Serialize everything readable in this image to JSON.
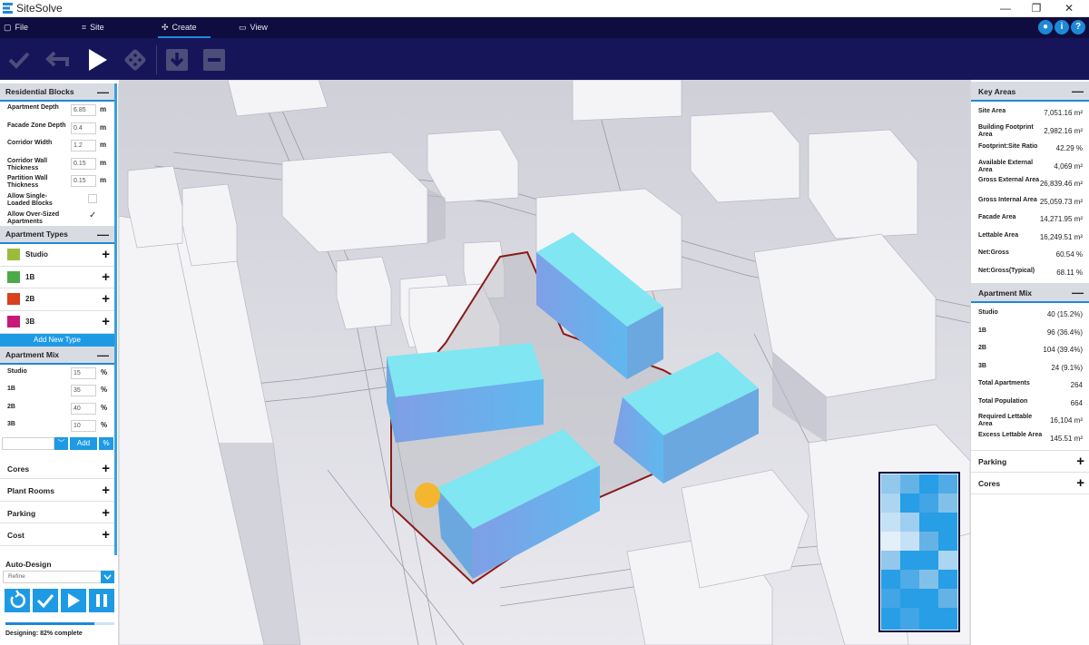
{
  "app": {
    "title": "SiteSolve"
  },
  "window": {
    "minimize": "—",
    "restore": "❐",
    "close": "✕"
  },
  "menu": {
    "tabs": [
      {
        "label": "File",
        "icon": "file-icon"
      },
      {
        "label": "Site",
        "icon": "site-icon"
      },
      {
        "label": "Create",
        "icon": "create-icon",
        "active": true
      },
      {
        "label": "View",
        "icon": "view-icon"
      }
    ],
    "help_icons": [
      "user-icon",
      "info-icon",
      "help-icon"
    ]
  },
  "toolbar": [
    "check-icon",
    "undo-icon",
    "play-icon",
    "dice-icon",
    "download-icon",
    "minus-icon"
  ],
  "left": {
    "residential": {
      "title": "Residential Blocks",
      "fields": [
        {
          "label": "Apartment Depth",
          "value": "6.85",
          "unit": "m"
        },
        {
          "label": "Facade Zone Depth",
          "value": "0.4",
          "unit": "m"
        },
        {
          "label": "Corridor Width",
          "value": "1.2",
          "unit": "m"
        },
        {
          "label": "Corridor Wall Thickness",
          "value": "0.15",
          "unit": "m"
        },
        {
          "label": "Partition Wall Thickness",
          "value": "0.15",
          "unit": "m"
        }
      ],
      "checks": [
        {
          "label": "Allow Single-Loaded Blocks",
          "checked": false
        },
        {
          "label": "Allow Over-Sized Apartments",
          "checked": true
        }
      ]
    },
    "types": {
      "title": "Apartment Types",
      "items": [
        {
          "label": "Studio",
          "color": "#9dbb3a"
        },
        {
          "label": "1B",
          "color": "#4caa4a"
        },
        {
          "label": "2B",
          "color": "#d9401e"
        },
        {
          "label": "3B",
          "color": "#c8187a"
        }
      ],
      "add_label": "Add New Type"
    },
    "mix": {
      "title": "Apartment Mix",
      "rows": [
        {
          "label": "Studio",
          "value": "15",
          "unit": "%"
        },
        {
          "label": "1B",
          "value": "35",
          "unit": "%"
        },
        {
          "label": "2B",
          "value": "40",
          "unit": "%"
        },
        {
          "label": "3B",
          "value": "10",
          "unit": "%"
        }
      ],
      "add_label": "Add",
      "pct_label": "%"
    },
    "collapsed": [
      "Cores",
      "Plant Rooms",
      "Parking",
      "Cost"
    ],
    "autodesign": {
      "title": "Auto-Design",
      "mode": "Refine"
    },
    "progress": {
      "text": "Designing: 82% complete",
      "value": 0.82
    }
  },
  "right": {
    "key_areas": {
      "title": "Key Areas",
      "rows": [
        {
          "label": "Site Area",
          "value": "7,051.16 m²"
        },
        {
          "label": "Building Footprint Area",
          "value": "2,982.16 m²"
        },
        {
          "label": "Footprint:Site Ratio",
          "value": "42.29 %"
        },
        {
          "label": "Available External Area",
          "value": "4,069 m²"
        },
        {
          "label": "Gross External Area",
          "value": "26,839.46 m²"
        },
        {
          "label": "Gross Internal Area",
          "value": "25,059.73 m²"
        },
        {
          "label": "Facade Area",
          "value": "14,271.95 m²"
        },
        {
          "label": "Lettable Area",
          "value": "16,249.51 m²"
        },
        {
          "label": "Net:Gross",
          "value": "60.54 %"
        },
        {
          "label": "Net:Gross(Typical)",
          "value": "68.11 %"
        }
      ]
    },
    "mix": {
      "title": "Apartment Mix",
      "rows": [
        {
          "label": "Studio",
          "value": "40 (15.2%)"
        },
        {
          "label": "1B",
          "value": "96 (36.4%)"
        },
        {
          "label": "2B",
          "value": "104 (39.4%)"
        },
        {
          "label": "3B",
          "value": "24 (9.1%)"
        },
        {
          "label": "Total Apartments",
          "value": "264"
        },
        {
          "label": "Total Population",
          "value": "664"
        },
        {
          "label": "Required Lettable Area",
          "value": "16,104 m²"
        },
        {
          "label": "Excess Lettable Area",
          "value": "145.51 m²"
        }
      ]
    },
    "sections": [
      "Parking",
      "Cores"
    ]
  },
  "colors": {
    "accent": "#1e88d8",
    "navy": "#0f0d3f",
    "toolbar": "#17155a",
    "building": "#7fe6f2",
    "site_boundary": "#8a1a1a"
  }
}
